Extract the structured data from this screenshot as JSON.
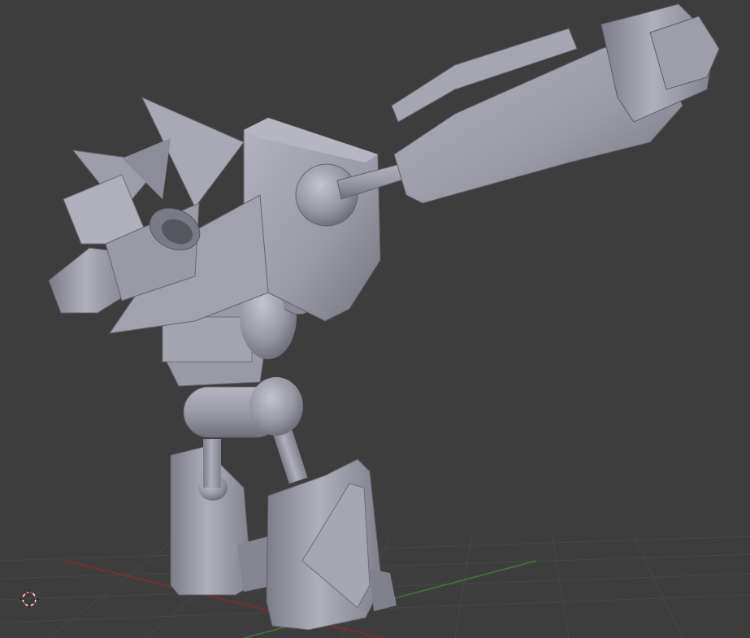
{
  "viewport": {
    "background": "#3d3d3d",
    "grid_color": "#4a4a4a",
    "x_axis_color": "#8a2a2a",
    "y_axis_color": "#3f7a2f"
  },
  "model": {
    "name_hidden": "",
    "base_color": "#9a9aa6",
    "light_color": "#b8b8c4",
    "dark_color": "#6e6e7a",
    "shadow_color": "#56565f"
  },
  "cursor": {
    "icon": "3d-cursor-icon",
    "ring_color": "#ffffff",
    "accent_color": "#d03030"
  }
}
